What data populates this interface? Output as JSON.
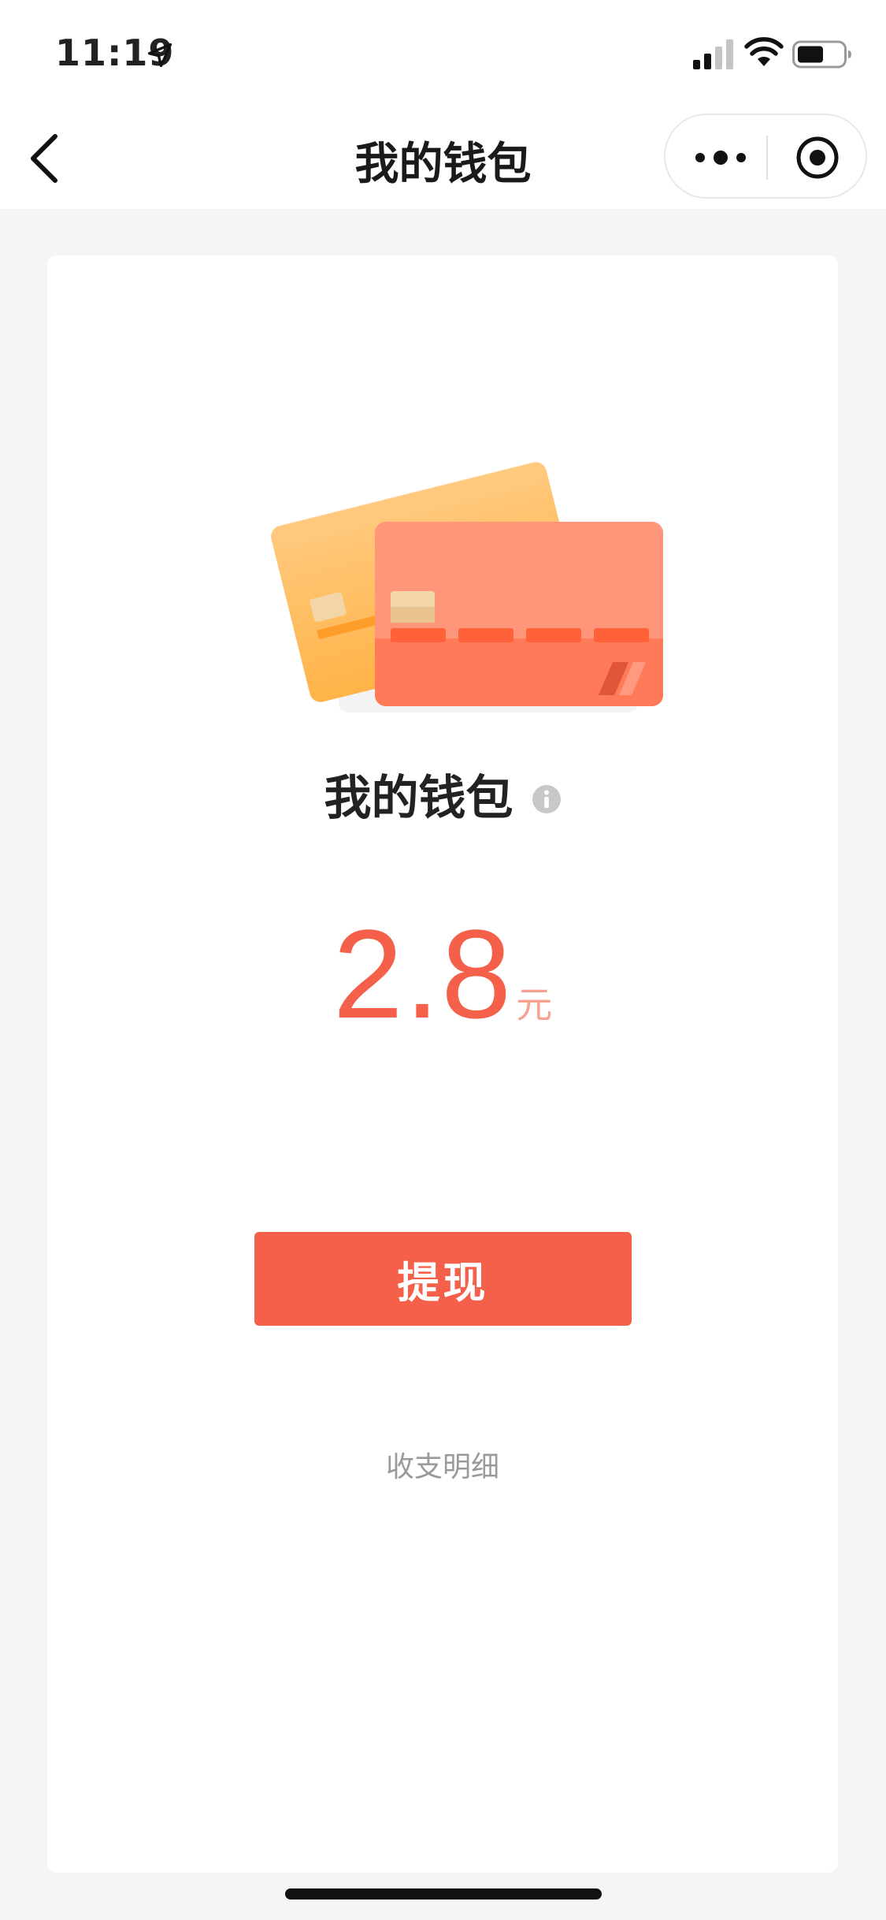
{
  "status_bar": {
    "time": "11:19",
    "icons": [
      "location-arrow-icon",
      "signal-icon",
      "wifi-icon",
      "battery-icon"
    ]
  },
  "nav": {
    "title": "我的钱包",
    "icons": [
      "back-icon",
      "more-icon",
      "target-icon"
    ]
  },
  "wallet": {
    "title": "我的钱包",
    "info_icon": "info-icon",
    "balance": "2.8",
    "unit": "元",
    "withdraw_label": "提现",
    "details_label": "收支明细"
  },
  "colors": {
    "accent": "#f5604a",
    "unit": "#f7a290",
    "background": "#f5f5f5"
  }
}
